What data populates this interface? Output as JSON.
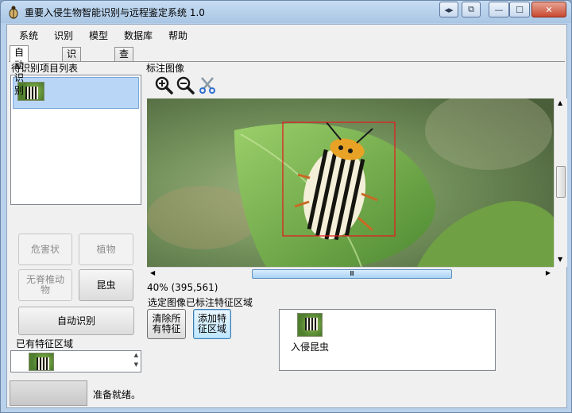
{
  "window": {
    "title": "重要入侵生物智能识别与远程鉴定系统 1.0",
    "buttons": {
      "swap": "◂▸",
      "restore_doc": "⧉",
      "minimize": "—",
      "maximize": "☐",
      "close": "✕"
    }
  },
  "menu": {
    "items": [
      "系统",
      "识别",
      "模型",
      "数据库",
      "帮助"
    ]
  },
  "tabs": [
    "自动识别",
    "识别结果",
    "查询"
  ],
  "left_panel": {
    "list_title": "待识别项目列表",
    "buttons": {
      "hazard": "危害状",
      "plant": "植物",
      "invertebrate": "无脊椎动\n物",
      "insect": "昆虫",
      "auto_identify": "自动识别"
    },
    "existing_regions_label": "已有特征区域",
    "spin_up": "▲",
    "spin_down": "▼"
  },
  "image_panel": {
    "title": "标注图像",
    "tools": [
      "zoom-in-icon",
      "zoom-out-icon",
      "scissors-icon"
    ],
    "zoom_readout": "40%  (395,561)",
    "h_thumb_grip": "Ⅲ",
    "scroll_left": "◀",
    "scroll_right": "▶",
    "scroll_up": "▲",
    "scroll_down": "▼"
  },
  "feature_panel": {
    "label": "选定图像已标注特征区域",
    "clear_button": "清除所\n有特征",
    "add_button": "添加特\n征区域",
    "item_caption": "入侵昆虫"
  },
  "status": {
    "text": "准备就绪。"
  },
  "colors": {
    "selection": "#b9d6f6",
    "annotation_box": "#e02020",
    "window_frame": "#b9d1ea"
  }
}
